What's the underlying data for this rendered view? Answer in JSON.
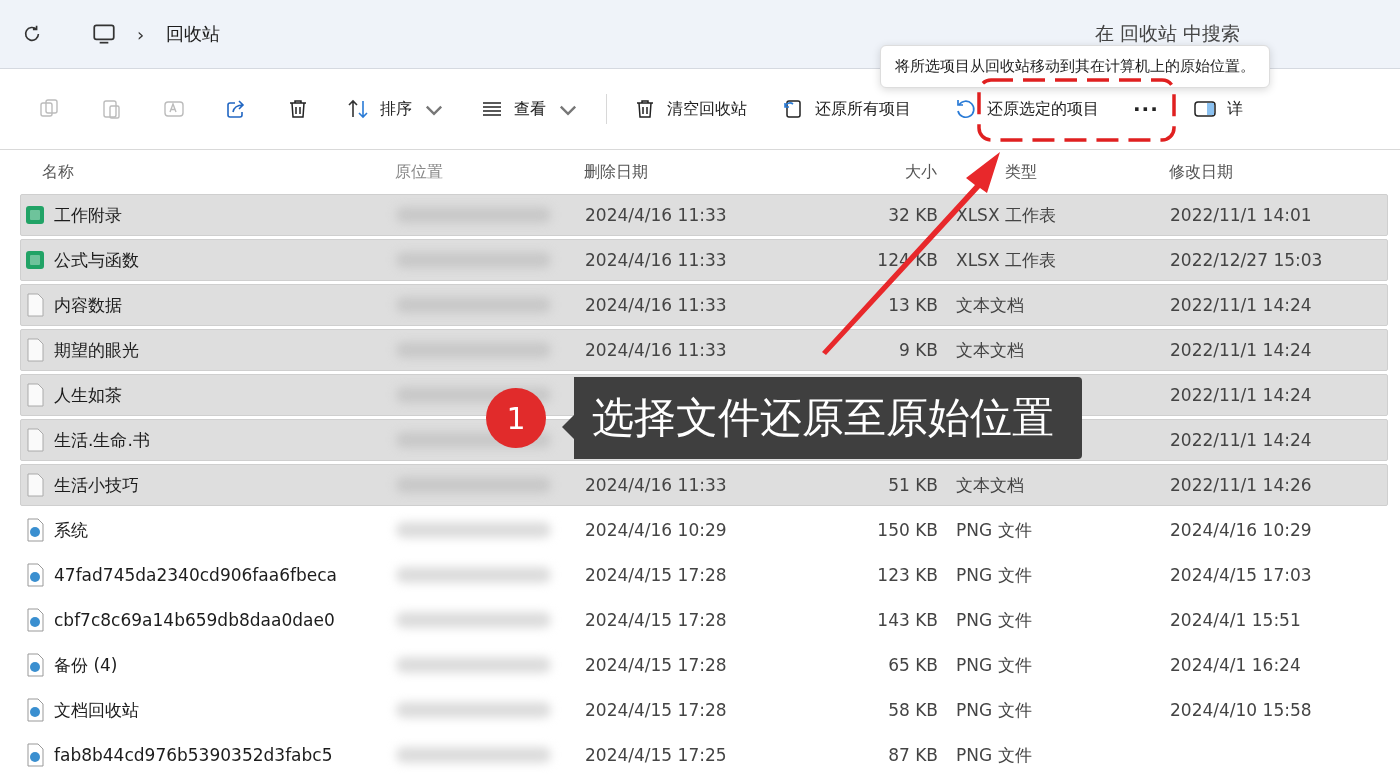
{
  "address_bar": {
    "separator": "›",
    "location": "回收站",
    "search_placeholder": "在 回收站 中搜索"
  },
  "tooltip": "将所选项目从回收站移动到其在计算机上的原始位置。",
  "toolbar": [
    {
      "kind": "icon",
      "disabled": true
    },
    {
      "kind": "icon",
      "disabled": true
    },
    {
      "kind": "icon",
      "disabled": true
    },
    {
      "kind": "icon",
      "disabled": false
    },
    {
      "kind": "icon",
      "disabled": false
    },
    {
      "kind": "menu",
      "label": "排序",
      "disabled": false
    },
    {
      "kind": "menu",
      "label": "查看",
      "disabled": false
    },
    {
      "kind": "divider"
    },
    {
      "kind": "label",
      "label": "清空回收站",
      "disabled": false
    },
    {
      "kind": "label",
      "label": "还原所有项目",
      "disabled": false
    },
    {
      "kind": "label",
      "label": "还原选定的项目",
      "disabled": false,
      "highlighted": true
    },
    {
      "kind": "more",
      "label": "···",
      "disabled": false
    },
    {
      "kind": "label",
      "label": "详",
      "disabled": false
    }
  ],
  "table": {
    "columns": [
      "名称",
      "原位置",
      "删除日期",
      "大小",
      "类型",
      "修改日期"
    ],
    "rows": [
      {
        "name": "工作附录",
        "kind": "spreadsheet",
        "selected": true,
        "deleted": "2024/4/16 11:33",
        "size": "32 KB",
        "type": "XLSX 工作表",
        "modified": "2022/11/1 14:01"
      },
      {
        "name": "公式与函数",
        "kind": "spreadsheet",
        "selected": true,
        "deleted": "2024/4/16 11:33",
        "size": "124 KB",
        "type": "XLSX 工作表",
        "modified": "2022/12/27 15:03"
      },
      {
        "name": "内容数据",
        "kind": "text",
        "selected": true,
        "deleted": "2024/4/16 11:33",
        "size": "13 KB",
        "type": "文本文档",
        "modified": "2022/11/1 14:24"
      },
      {
        "name": "期望的眼光",
        "kind": "text",
        "selected": true,
        "deleted": "2024/4/16 11:33",
        "size": "9 KB",
        "type": "文本文档",
        "modified": "2022/11/1 14:24"
      },
      {
        "name": "人生如茶",
        "kind": "text",
        "selected": true,
        "modified": "2022/11/1 14:24"
      },
      {
        "name": "生活.生命.书",
        "kind": "text",
        "selected": true,
        "modified": "2022/11/1 14:24"
      },
      {
        "name": "生活小技巧",
        "kind": "text",
        "selected": true,
        "deleted": "2024/4/16 11:33",
        "size": "51 KB",
        "type": "文本文档",
        "modified": "2022/11/1 14:26"
      },
      {
        "name": "系统",
        "kind": "image",
        "selected": false,
        "deleted": "2024/4/16 10:29",
        "size": "150 KB",
        "type": "PNG 文件",
        "modified": "2024/4/16 10:29"
      },
      {
        "name": "47fad745da2340cd906faa6fbeca",
        "kind": "image",
        "selected": false,
        "deleted": "2024/4/15 17:28",
        "size": "123 KB",
        "type": "PNG 文件",
        "modified": "2024/4/15 17:03"
      },
      {
        "name": "cbf7c8c69a14b659db8daa0dae0",
        "kind": "image",
        "selected": false,
        "deleted": "2024/4/15 17:28",
        "size": "143 KB",
        "type": "PNG 文件",
        "modified": "2024/4/1 15:51"
      },
      {
        "name": "备份 (4)",
        "kind": "image",
        "selected": false,
        "deleted": "2024/4/15 17:28",
        "size": "65 KB",
        "type": "PNG 文件",
        "modified": "2024/4/1 16:24"
      },
      {
        "name": "文档回收站",
        "kind": "image",
        "selected": false,
        "deleted": "2024/4/15 17:28",
        "size": "58 KB",
        "type": "PNG 文件",
        "modified": "2024/4/10 15:58"
      },
      {
        "name": "fab8b44cd976b5390352d3fabc5",
        "kind": "image",
        "selected": false,
        "deleted": "2024/4/15 17:25",
        "size": "87 KB",
        "type": "PNG 文件"
      }
    ]
  },
  "callout": {
    "step": "1",
    "text": "选择文件还原至原始位置"
  }
}
